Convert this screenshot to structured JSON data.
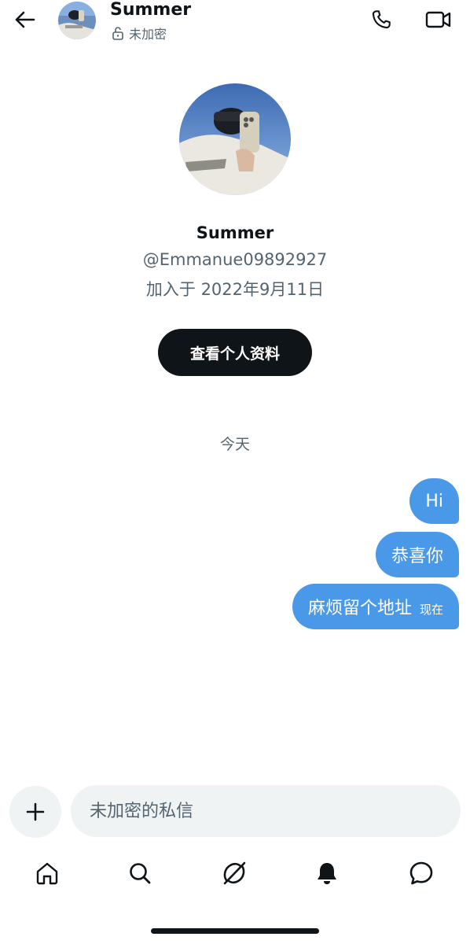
{
  "header": {
    "name": "Summer",
    "encryption_status": "未加密"
  },
  "profile": {
    "name": "Summer",
    "handle": "@Emmanue09892927",
    "joined": "加入于 2022年9月11日",
    "view_profile_label": "查看个人资料"
  },
  "conversation": {
    "date_divider": "今天",
    "messages": [
      {
        "text": "Hi",
        "time": ""
      },
      {
        "text": "恭喜你",
        "time": ""
      },
      {
        "text": "麻烦留个地址",
        "time": "现在"
      }
    ]
  },
  "composer": {
    "placeholder": "未加密的私信"
  },
  "colors": {
    "bubble": "#4a99e9",
    "button_dark": "#0f1419",
    "muted_text": "#536471",
    "input_bg": "#eff3f4"
  },
  "icons": {
    "back": "back-arrow-icon",
    "call": "phone-icon",
    "video": "video-icon",
    "lock": "unlock-icon",
    "add": "plus-icon",
    "nav": [
      "home-icon",
      "search-icon",
      "grok-icon",
      "bell-icon",
      "messages-icon"
    ]
  }
}
